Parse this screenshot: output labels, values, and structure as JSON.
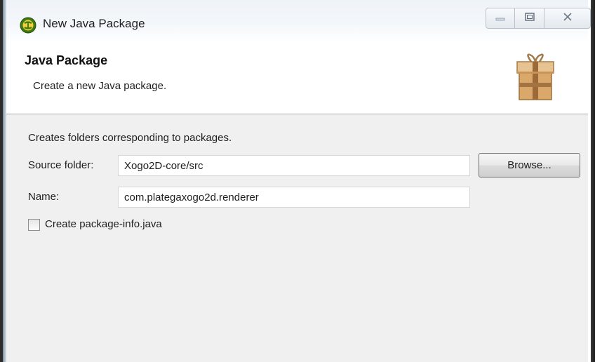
{
  "window": {
    "title": "New Java Package",
    "icon": "eclipse-icon"
  },
  "caption_buttons": {
    "minimize_icon": "minimize-icon",
    "maximize_icon": "maximize-icon",
    "close_icon": "close-icon"
  },
  "header": {
    "title": "Java Package",
    "description": "Create a new Java package.",
    "icon": "package-icon"
  },
  "content": {
    "description": "Creates folders corresponding to packages.",
    "source_folder": {
      "label": "Source folder:",
      "value": "Xogo2D-core/src",
      "browse_label": "Browse..."
    },
    "name": {
      "label": "Name:",
      "value": "com.plategaxogo2d.renderer"
    },
    "package_info_checkbox": {
      "label": "Create package-info.java",
      "checked": false
    }
  },
  "colors": {
    "header_background": "#ffffff",
    "content_background": "#f0f0f0",
    "input_border": "#d6d6d6"
  }
}
